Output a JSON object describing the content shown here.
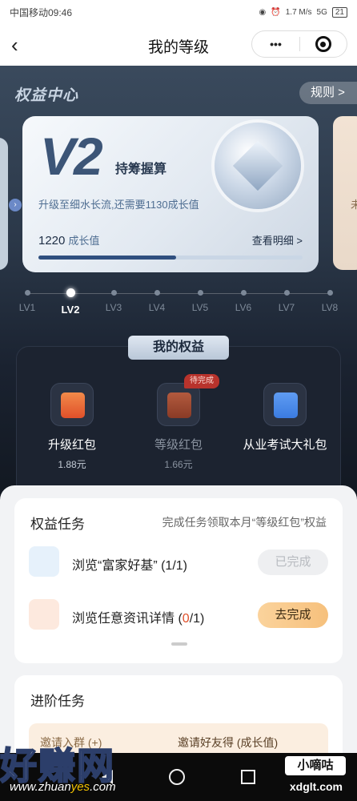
{
  "status_bar": {
    "carrier_time": "中国移动09:46",
    "net_speed": "1.7 M/s",
    "network": "5G",
    "battery": "21"
  },
  "nav": {
    "title": "我的等级",
    "more_label": "•••"
  },
  "hero": {
    "section_title": "权益中心",
    "rules_label": "规则 >",
    "right_card_text": "未",
    "card": {
      "level": "V2",
      "level_name": "持筹握算",
      "hint": "升级至细水长流,还需要1130成长值",
      "growth_value": "1220",
      "growth_unit": "成长值",
      "detail_label": "查看明细 >",
      "progress": 0.52
    },
    "levels": [
      "LV1",
      "LV2",
      "LV3",
      "LV4",
      "LV5",
      "LV6",
      "LV7",
      "LV8"
    ],
    "active_level": "LV2"
  },
  "benefits": {
    "title": "我的权益",
    "items": [
      {
        "name": "升级红包",
        "value": "1.88元",
        "badge": ""
      },
      {
        "name": "等级红包",
        "value": "1.66元",
        "badge": "待完成"
      },
      {
        "name": "从业考试大礼包",
        "value": "",
        "badge": ""
      }
    ]
  },
  "tasks": {
    "title": "权益任务",
    "description": "完成任务领取本月“等级红包”权益",
    "rows": [
      {
        "name": "浏览“富家好基” (1/1)",
        "button": "已完成",
        "state": "done"
      },
      {
        "name_prefix": "浏览任意资讯详情 (",
        "count": "0",
        "name_suffix": "/1)",
        "button": "去完成",
        "state": "todo"
      }
    ]
  },
  "advanced": {
    "title": "进阶任务",
    "item_left": "邀请入群 (+)",
    "item_right": "邀请好友得 (成长值)"
  },
  "watermark": {
    "logo": "好赚网",
    "url_prefix": "www.zhuan",
    "url_highlight": "yes",
    "url_suffix": ".com",
    "badge": "小嘀咕",
    "site": "xdglt.com"
  },
  "colors": {
    "accent": "#2f4f7f",
    "button_gold": "#f6c07c",
    "pending_badge": "#b8332c",
    "highlight": "#e0502a"
  }
}
